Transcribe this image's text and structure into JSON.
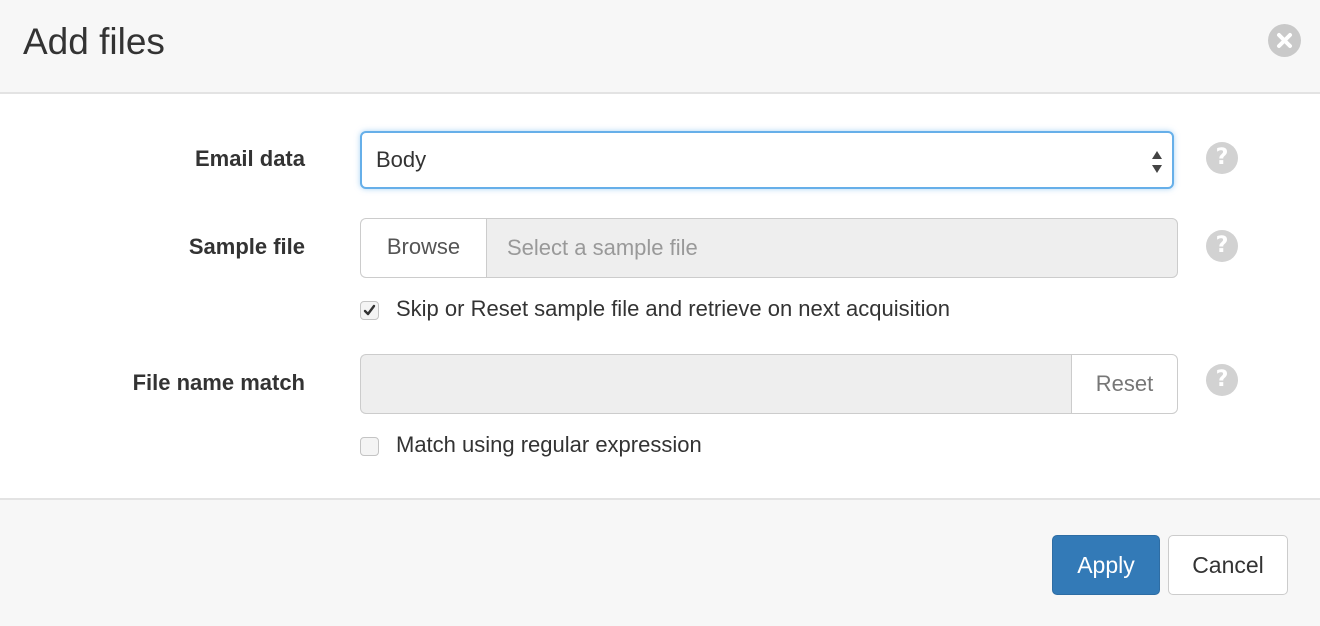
{
  "dialog": {
    "title": "Add files"
  },
  "form": {
    "email_data": {
      "label": "Email data",
      "selected": "Body"
    },
    "sample_file": {
      "label": "Sample file",
      "browse_label": "Browse",
      "placeholder": "Select a sample file",
      "skip_checkbox_label": "Skip or Reset sample file and retrieve on next acquisition",
      "skip_checked": true
    },
    "file_name_match": {
      "label": "File name match",
      "value": "",
      "reset_label": "Reset",
      "regex_checkbox_label": "Match using regular expression",
      "regex_checked": false
    }
  },
  "footer": {
    "apply_label": "Apply",
    "cancel_label": "Cancel"
  },
  "icons": {
    "close": "close-icon",
    "help": "question-circle-icon",
    "select_arrows": "sort-arrows-icon",
    "check": "checkmark-icon"
  },
  "colors": {
    "primary": "#337ab7",
    "focus": "#66afe9",
    "help_icon": "#d2d2d2",
    "header_bg": "#f7f7f7"
  }
}
